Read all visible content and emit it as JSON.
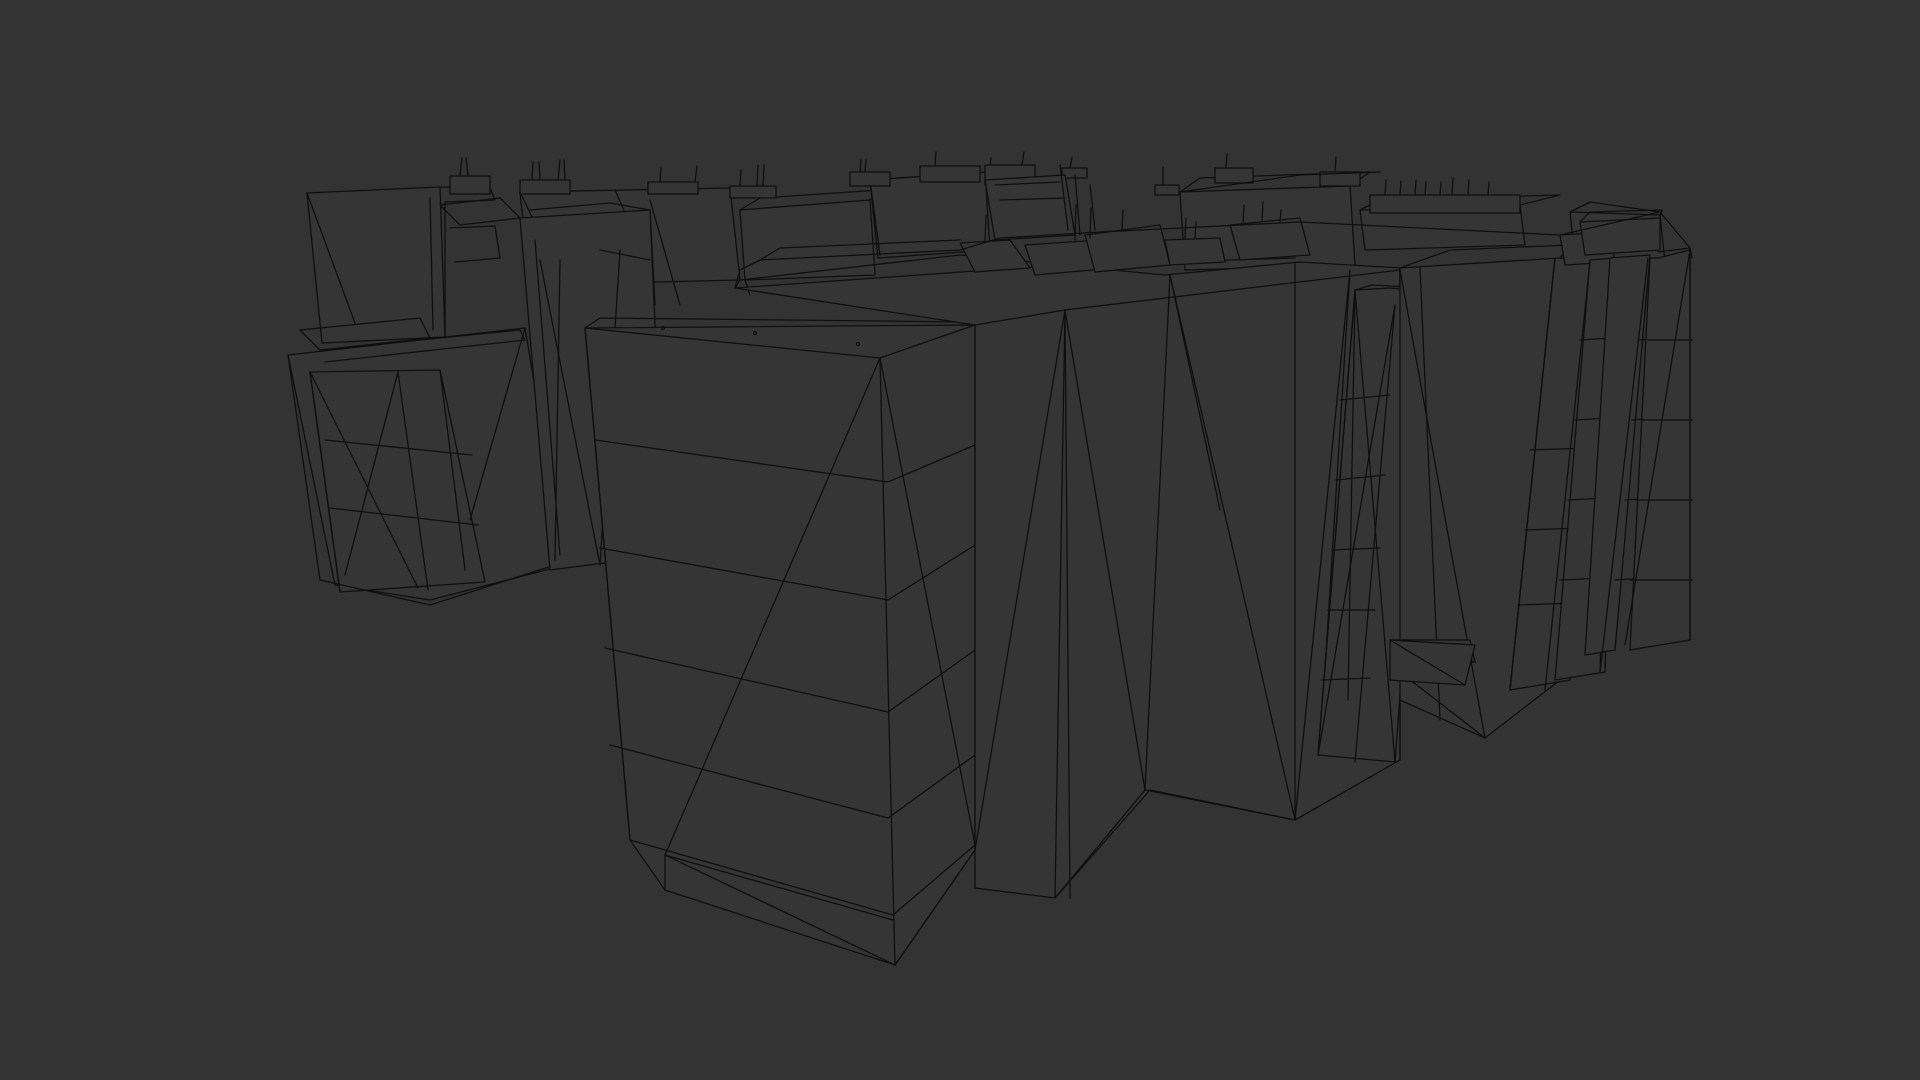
{
  "viewport": {
    "background_color": "#333333",
    "wireframe_color": "#0f0f0f",
    "object": "building-block-wireframe"
  }
}
